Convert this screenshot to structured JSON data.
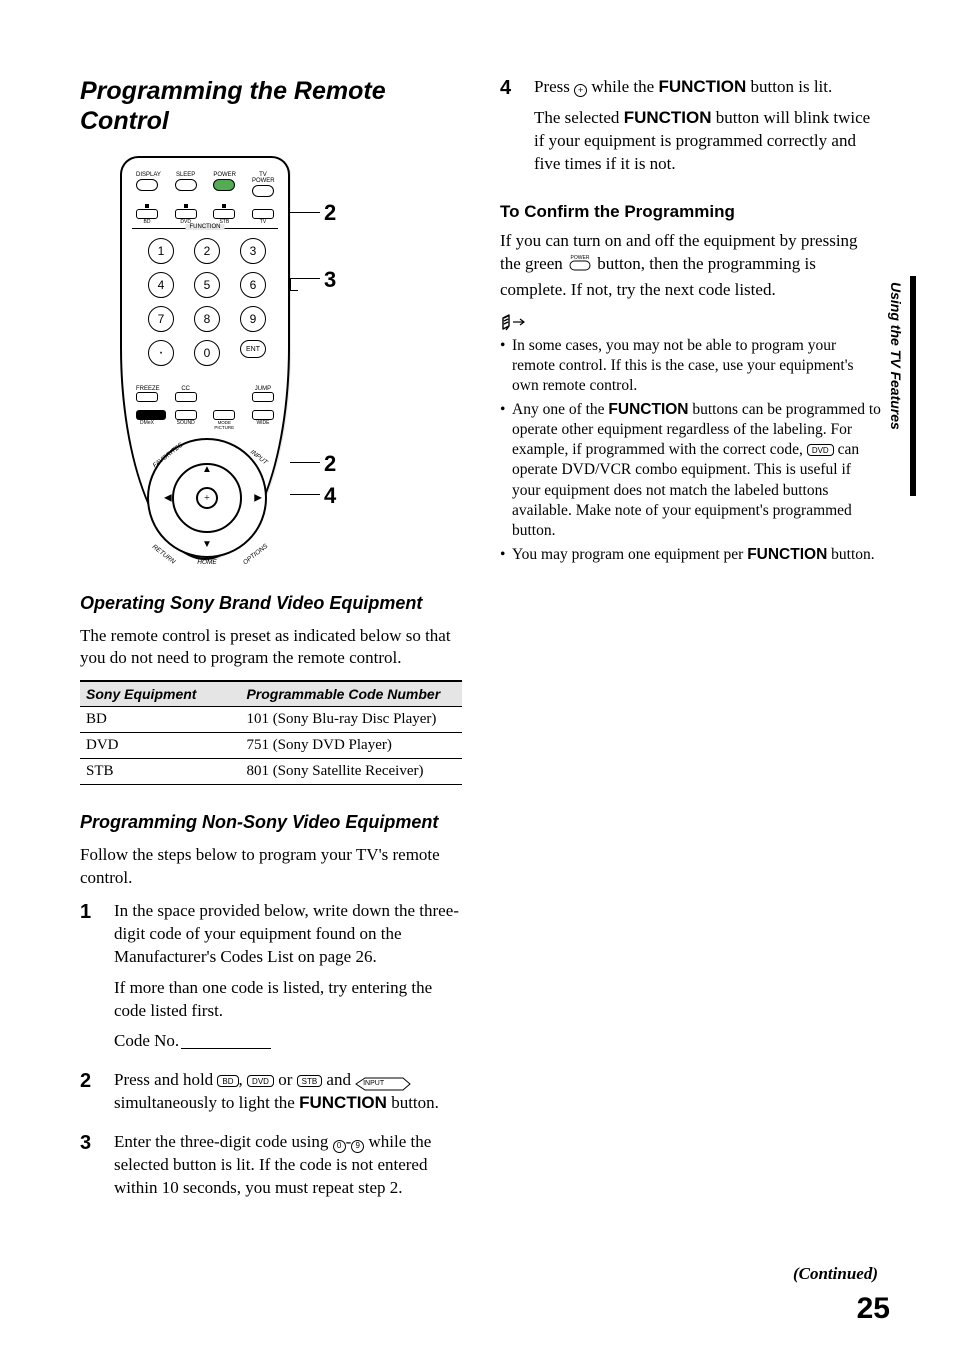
{
  "page": {
    "number": "25",
    "continued": "(Continued)",
    "side_tab": "Using the TV Features"
  },
  "left": {
    "title": "Programming the Remote Control",
    "callouts": {
      "a": "2",
      "b": "3",
      "c": "2",
      "d": "4"
    },
    "remote_labels": {
      "display": "DISPLAY",
      "sleep": "SLEEP",
      "power": "POWER",
      "tvpower": "TV POWER",
      "bd": "BD",
      "dvd": "DVD",
      "stb": "STB",
      "tv": "TV",
      "function": "FUNCTION",
      "ent": "ENT",
      "freeze": "FREEZE",
      "cc": "CC",
      "jump": "JUMP",
      "dmex": "DMeX",
      "sound": "SOUND",
      "mode": "MODE",
      "picture": "PICTURE",
      "wide": "WIDE",
      "favorites": "FAVORITES",
      "input": "INPUT",
      "return": "RETURN",
      "options": "OPTIONS",
      "home": "HOME"
    },
    "section_sony": {
      "heading": "Operating Sony Brand Video Equipment",
      "intro": "The remote control is preset as indicated below so that you do not need to program the remote control.",
      "table": {
        "headers": [
          "Sony Equipment",
          "Programmable Code Number"
        ],
        "rows": [
          [
            "BD",
            "101 (Sony Blu-ray Disc Player)"
          ],
          [
            "DVD",
            "751 (Sony DVD Player)"
          ],
          [
            "STB",
            "801 (Sony Satellite Receiver)"
          ]
        ]
      }
    },
    "section_nonsony": {
      "heading": "Programming Non-Sony Video Equipment",
      "intro": "Follow the steps below to program your TV's remote control.",
      "steps": {
        "s1_a": "In the space provided below, write down the three-digit code of your equipment found on the Manufacturer's Codes List on page 26.",
        "s1_b": "If more than one code is listed, try entering the code listed first.",
        "s1_code": "Code No.",
        "s2_a": "Press and hold ",
        "s2_b": ", ",
        "s2_c": " or ",
        "s2_d": " and ",
        "s2_e": " simultaneously to light the ",
        "s2_fn": "FUNCTION",
        "s2_f": " button.",
        "s3_a": "Enter the three-digit code using ",
        "s3_sep": "-",
        "s3_b": " while the selected button is lit. If the code is not entered within 10 seconds, you must repeat step 2."
      },
      "icons": {
        "bd": "BD",
        "dvd": "DVD",
        "stb": "STB",
        "input": "INPUT",
        "d0": "0",
        "d9": "9"
      }
    }
  },
  "right": {
    "step4": {
      "num": "4",
      "a": "Press ",
      "b": " while the ",
      "fn": "FUNCTION",
      "c": " button is lit.",
      "d": "The selected ",
      "e": " button will blink twice if your equipment is programmed correctly and five times if it is not."
    },
    "confirm": {
      "heading": "To Confirm the Programming",
      "a": "If you can turn on and off the equipment by pressing the green ",
      "power_label": "POWER",
      "b": " button, then the programming is complete. If not, try the next code listed."
    },
    "notes": {
      "n1": "In some cases, you may not be able to program your remote control. If this is the case, use your equipment's own remote control.",
      "n2_a": "Any one of the ",
      "n2_fn": "FUNCTION",
      "n2_b": " buttons can be programmed to operate other equipment regardless of the labeling. For example, if programmed with the correct code, ",
      "n2_dvd": "DVD",
      "n2_c": " can operate DVD/VCR combo equipment. This is useful if your equipment does not match the labeled buttons available. Make note of your equipment's programmed button.",
      "n3_a": "You may program one equipment per ",
      "n3_fn": "FUNCTION",
      "n3_b": " button."
    }
  }
}
